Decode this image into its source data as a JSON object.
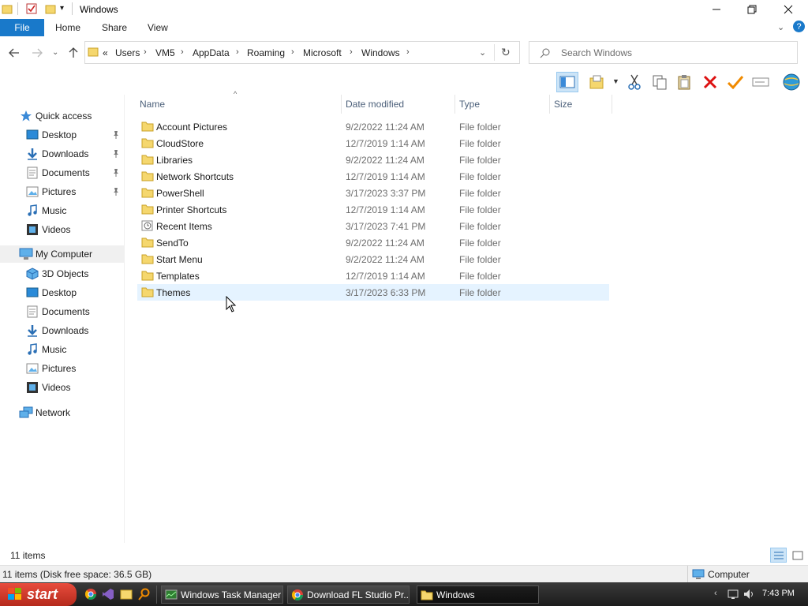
{
  "window": {
    "title": "Windows"
  },
  "ribbon": {
    "tabs": [
      "File",
      "Home",
      "Share",
      "View"
    ]
  },
  "address": {
    "overflow": "«",
    "crumbs": [
      "Users",
      "VM5",
      "AppData",
      "Roaming",
      "Microsoft",
      "Windows"
    ]
  },
  "search": {
    "placeholder": "Search Windows"
  },
  "nav": {
    "quick_access": "Quick access",
    "quick_items": [
      {
        "label": "Desktop",
        "icon": "desktop-icon",
        "pinned": true
      },
      {
        "label": "Downloads",
        "icon": "downloads-icon",
        "pinned": true
      },
      {
        "label": "Documents",
        "icon": "documents-icon",
        "pinned": true
      },
      {
        "label": "Pictures",
        "icon": "pictures-icon",
        "pinned": true
      },
      {
        "label": "Music",
        "icon": "music-icon",
        "pinned": false
      },
      {
        "label": "Videos",
        "icon": "videos-icon",
        "pinned": false
      }
    ],
    "my_computer": "My Computer",
    "computer_items": [
      {
        "label": "3D Objects",
        "icon": "3d-objects-icon"
      },
      {
        "label": "Desktop",
        "icon": "desktop-icon"
      },
      {
        "label": "Documents",
        "icon": "documents-icon"
      },
      {
        "label": "Downloads",
        "icon": "downloads-icon"
      },
      {
        "label": "Music",
        "icon": "music-icon"
      },
      {
        "label": "Pictures",
        "icon": "pictures-icon"
      },
      {
        "label": "Videos",
        "icon": "videos-icon"
      }
    ],
    "network": "Network"
  },
  "columns": {
    "name": "Name",
    "date": "Date modified",
    "type": "Type",
    "size": "Size"
  },
  "files": [
    {
      "name": "Account Pictures",
      "date": "9/2/2022 11:24 AM",
      "type": "File folder",
      "icon": "folder-icon"
    },
    {
      "name": "CloudStore",
      "date": "12/7/2019 1:14 AM",
      "type": "File folder",
      "icon": "folder-icon"
    },
    {
      "name": "Libraries",
      "date": "9/2/2022 11:24 AM",
      "type": "File folder",
      "icon": "folder-icon"
    },
    {
      "name": "Network Shortcuts",
      "date": "12/7/2019 1:14 AM",
      "type": "File folder",
      "icon": "folder-icon"
    },
    {
      "name": "PowerShell",
      "date": "3/17/2023 3:37 PM",
      "type": "File folder",
      "icon": "folder-icon"
    },
    {
      "name": "Printer Shortcuts",
      "date": "12/7/2019 1:14 AM",
      "type": "File folder",
      "icon": "folder-icon"
    },
    {
      "name": "Recent Items",
      "date": "3/17/2023 7:41 PM",
      "type": "File folder",
      "icon": "recent-items-icon"
    },
    {
      "name": "SendTo",
      "date": "9/2/2022 11:24 AM",
      "type": "File folder",
      "icon": "folder-icon"
    },
    {
      "name": "Start Menu",
      "date": "9/2/2022 11:24 AM",
      "type": "File folder",
      "icon": "folder-icon"
    },
    {
      "name": "Templates",
      "date": "12/7/2019 1:14 AM",
      "type": "File folder",
      "icon": "folder-icon"
    },
    {
      "name": "Themes",
      "date": "3/17/2023 6:33 PM",
      "type": "File folder",
      "icon": "folder-icon",
      "selected": true
    }
  ],
  "status": {
    "item_count": "11 items",
    "disk_info": "11 items (Disk free space: 36.5 GB)",
    "location": "Computer"
  },
  "taskbar": {
    "start": "start",
    "tasks": [
      {
        "label": "Windows Task Manager",
        "icon": "task-manager-icon",
        "active": false
      },
      {
        "label": "Download FL Studio Pr...",
        "icon": "chrome-icon",
        "active": false
      },
      {
        "label": "Windows",
        "icon": "folder-icon",
        "active": true
      }
    ],
    "clock": "7:43 PM"
  },
  "colors": {
    "file_tab": "#1979ca",
    "selection": "#e5f3ff",
    "folder": "#f5d76e",
    "start": "#d0392b"
  }
}
